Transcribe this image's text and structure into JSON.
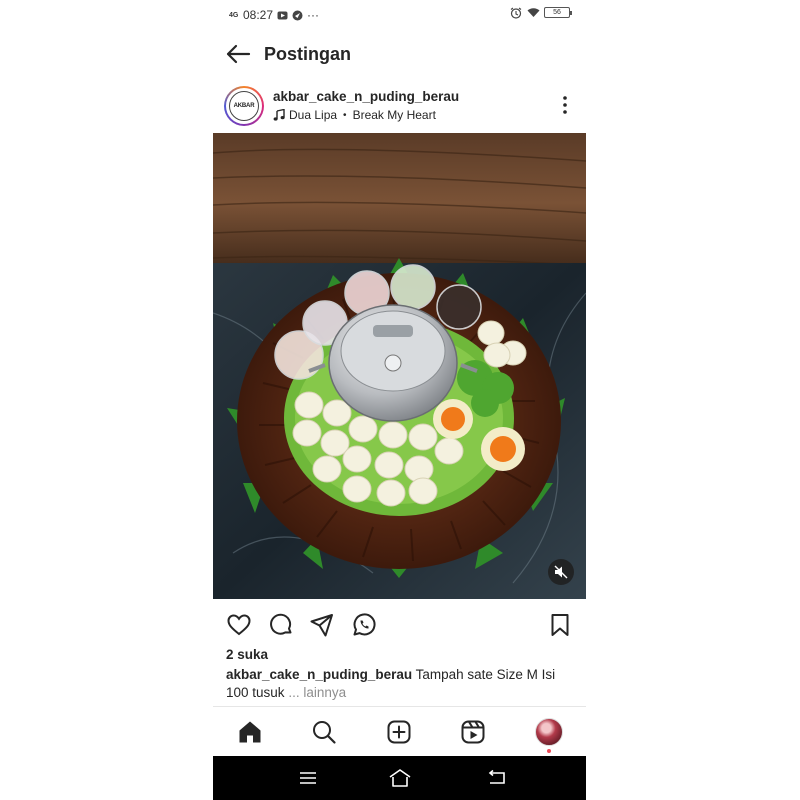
{
  "status_bar": {
    "network": "4G",
    "time": "08:27",
    "extra": "···",
    "battery": "56"
  },
  "header": {
    "title": "Postingan"
  },
  "post": {
    "username": "akbar_cake_n_puding_berau",
    "music_artist": "Dua Lipa",
    "music_separator": "•",
    "music_track": "Break My Heart",
    "avatar_logo_text": "AKBAR",
    "likes": "2 suka",
    "caption_user": "akbar_cake_n_puding_berau",
    "caption_text": "Tampah sate Size M Isi 100 tusuk",
    "caption_more": "... lainnya"
  },
  "icons": {
    "back": "arrow-left",
    "more": "three-dots-vertical",
    "like": "heart-outline",
    "comment": "speech-bubble",
    "share": "paper-plane",
    "whatsapp": "whatsapp",
    "save": "bookmark",
    "mute": "speaker-muted",
    "nav_home": "home-filled",
    "nav_search": "magnifier",
    "nav_add": "plus-square",
    "nav_reels": "reels",
    "sys_menu": "three-lines",
    "sys_home": "house-outline",
    "sys_back": "return-arrow"
  },
  "colors": {
    "text": "#262626",
    "muted": "#8e8e8e",
    "notification_dot": "#ed4956",
    "system_bar": "#000000"
  }
}
